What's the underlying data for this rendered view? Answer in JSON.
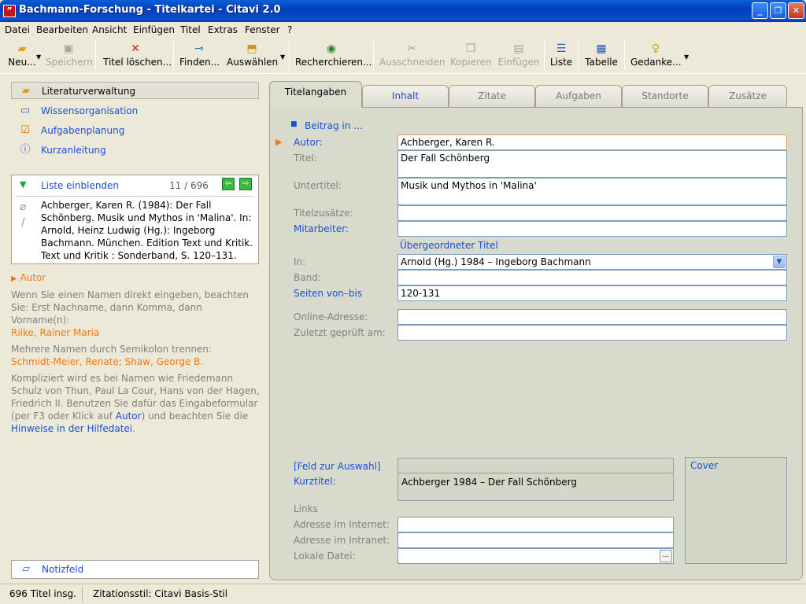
{
  "window": {
    "title": "Bachmann-Forschung - Titelkartei - Citavi 2.0",
    "app_icon": "quote-icon",
    "minimize": "_",
    "maximize": "❐",
    "close": "✕"
  },
  "menu": [
    "Datei",
    "Bearbeiten",
    "Ansicht",
    "Einfügen",
    "Titel",
    "Extras",
    "Fenster",
    "?"
  ],
  "toolbar": {
    "neu": "Neu...",
    "speichern": "Speichern",
    "titel_loeschen": "Titel löschen...",
    "finden": "Finden...",
    "auswaehlen": "Auswählen",
    "recherchieren": "Recherchieren...",
    "ausschneiden": "Ausschneiden",
    "kopieren": "Kopieren",
    "einfuegen": "Einfügen",
    "liste": "Liste",
    "tabelle": "Tabelle",
    "gedanke": "Gedanke..."
  },
  "nav": {
    "items": [
      "Literaturverwaltung",
      "Wissensorganisation",
      "Aufgabenplanung",
      "Kurzanleitung"
    ]
  },
  "list": {
    "toggle": "Liste einblenden",
    "counter": "11 / 696",
    "citation": "Achberger, Karen R. (1984): Der Fall Schönberg. Musik und Mythos in 'Malina'. In: Arnold, Heinz Ludwig (Hg.): Ingeborg Bachmann. München. Edition Text und Kritik. Text und Kritik : Sonderband, S. 120–131."
  },
  "help": {
    "heading": "Autor",
    "p1": "Wenn Sie einen Namen direkt eingeben, beachten Sie: Erst Nachname, dann Komma, dann Vorname(n):",
    "ex1": "Rilke, Rainer Maria",
    "p2": "Mehrere Namen durch Semikolon trennen:",
    "ex2": "Schmidt-Meier, Renate; Shaw, George B.",
    "p3a": "Kompliziert wird es bei Namen wie Friedemann Schulz von Thun, Paul La Cour, Hans von der Hagen, Friedrich II. Benutzen Sie dafür das Eingabeformular (per F3 oder Klick auf ",
    "p3link": "Autor",
    "p3b": ") und beachten Sie die ",
    "p3link2": "Hinweise in der Hilfedatei",
    "p3c": "."
  },
  "notiz": "Notizfeld",
  "status": {
    "count": "696 Titel insg.",
    "style": "Zitationsstil: Citavi Basis-Stil"
  },
  "tabs": [
    "Titelangaben",
    "Inhalt",
    "Zitate",
    "Aufgaben",
    "Standorte",
    "Zusätze"
  ],
  "form": {
    "type": "Beitrag in ...",
    "labels": {
      "autor": "Autor:",
      "titel": "Titel:",
      "untertitel": "Untertitel:",
      "titelzusaetze": "Titelzusätze:",
      "mitarbeiter": "Mitarbeiter:",
      "uebergeordnet": "Übergeordneter Titel",
      "in": "In:",
      "band": "Band:",
      "seiten": "Seiten von–bis",
      "online": "Online-Adresse:",
      "zuletzt": "Zuletzt geprüft am:",
      "feldauswahl": "[Feld zur Auswahl]",
      "kurztitel": "Kurztitel:",
      "links": "Links",
      "internet": "Adresse im Internet:",
      "intranet": "Adresse im Intranet:",
      "lokal": "Lokale Datei:",
      "cover": "Cover"
    },
    "values": {
      "autor": "Achberger, Karen R.",
      "titel": "Der Fall Schönberg",
      "untertitel": "Musik und Mythos in 'Malina'",
      "titelzusaetze": "",
      "mitarbeiter": "",
      "in": "Arnold (Hg.) 1984 – Ingeborg Bachmann",
      "band": "",
      "seiten": "120-131",
      "online": "",
      "zuletzt": "",
      "kurztitel": "Achberger 1984 – Der Fall Schönberg",
      "internet": "",
      "intranet": "",
      "lokal": ""
    },
    "browse": "..."
  }
}
